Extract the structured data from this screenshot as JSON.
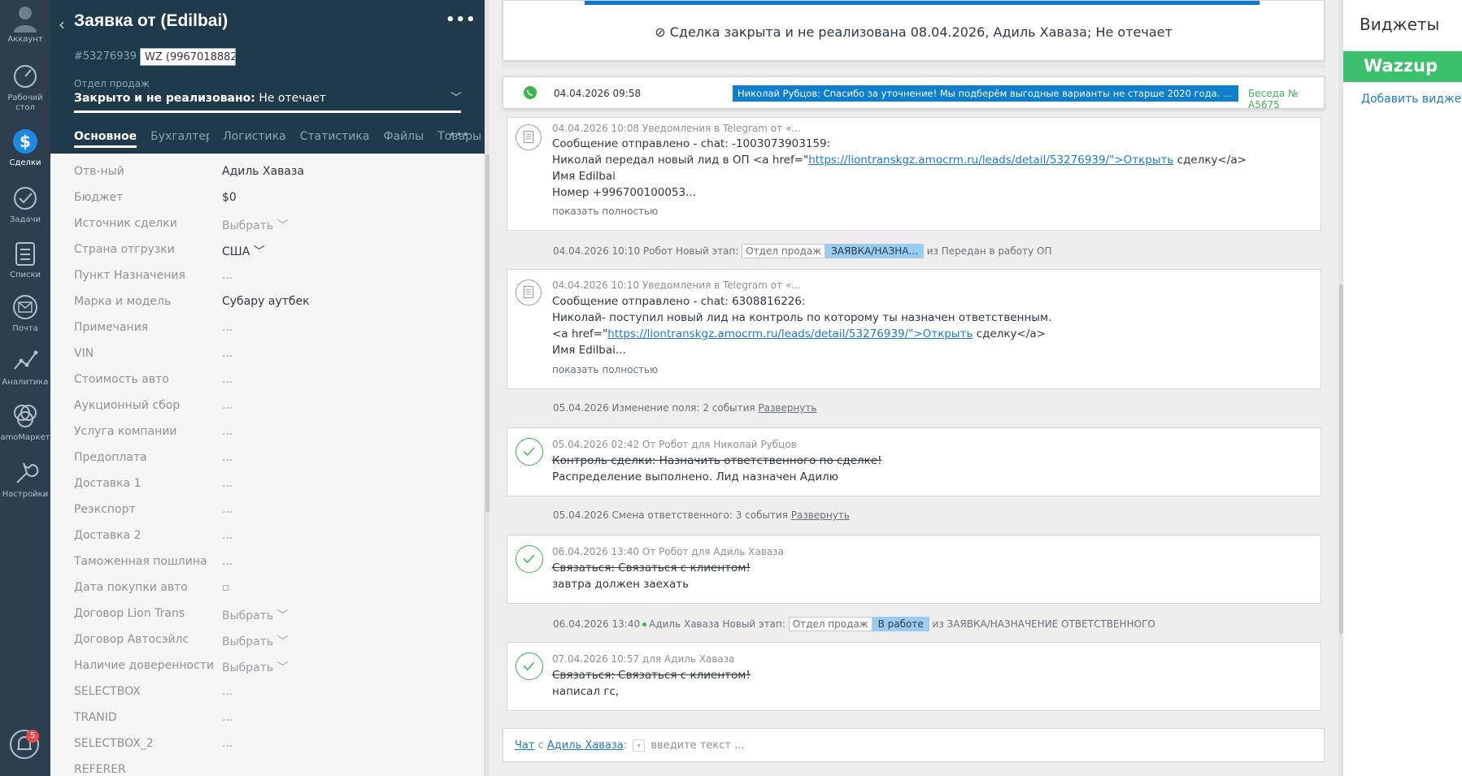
{
  "nav": {
    "account": "Аккаунт",
    "dashboard": "Рабочий стол",
    "leads": "Сделки",
    "tasks": "Задачи",
    "lists": "Списки",
    "mail": "Почта",
    "analytics": "Аналитика",
    "market": "amoМаркет",
    "settings": "Настройки",
    "notifications_count": "5"
  },
  "card": {
    "title": "Заявка от (Edilbai)",
    "more": "•••",
    "deal_id": "#53276939",
    "tag": "WZ (9967018882",
    "pipeline_label": "Отдел продаж",
    "pipeline_stage": "Закрыто и не реализовано:",
    "pipeline_reason": "Не отечает",
    "tabs": [
      "Основное",
      "Бухгалтер",
      "Логистика",
      "Статистика",
      "Файлы",
      "Товары"
    ],
    "tabs_more": "•••",
    "fields": [
      {
        "label": "Отв-ный",
        "value": "Адиль Хаваза",
        "dim": false
      },
      {
        "label": "Бюджет",
        "value": "$0",
        "dim": false
      },
      {
        "label": "Источник сделки",
        "value": "Выбрать ﹀",
        "dim": true
      },
      {
        "label": "Страна отгрузки",
        "value": "США ﹀",
        "dim": false
      },
      {
        "label": "Пункт Назначения",
        "value": "...",
        "dim": true
      },
      {
        "label": "Марка и модель",
        "value": "Субару аутбек",
        "dim": false
      },
      {
        "label": "Примечания",
        "value": "...",
        "dim": true
      },
      {
        "label": "VIN",
        "value": "...",
        "dim": true
      },
      {
        "label": "Стоимость авто",
        "value": "...",
        "dim": true
      },
      {
        "label": "Аукционный сбор",
        "value": "...",
        "dim": true
      },
      {
        "label": "Услуга компании",
        "value": "...",
        "dim": true
      },
      {
        "label": "Предоплата",
        "value": "...",
        "dim": true
      },
      {
        "label": "Доставка 1",
        "value": "...",
        "dim": true
      },
      {
        "label": "Реэкспорт",
        "value": "...",
        "dim": true
      },
      {
        "label": "Доставка 2",
        "value": "...",
        "dim": true
      },
      {
        "label": "Таможенная пошлина",
        "value": "...",
        "dim": true
      },
      {
        "label": "Дата покупки авто",
        "value": "▫",
        "dim": true
      },
      {
        "label": "Договор Lion Trans",
        "value": "Выбрать ﹀",
        "dim": true
      },
      {
        "label": "Договор Автосэйлс",
        "value": "Выбрать ﹀",
        "dim": true
      },
      {
        "label": "Наличие доверенности",
        "value": "Выбрать ﹀",
        "dim": true
      },
      {
        "label": "SELECTBOX",
        "value": "...",
        "dim": true
      },
      {
        "label": "TRANID",
        "value": "...",
        "dim": true
      },
      {
        "label": "SELECTBOX_2",
        "value": "...",
        "dim": true
      },
      {
        "label": "REFERER",
        "value": "",
        "dim": true
      }
    ]
  },
  "feed": {
    "closed_banner": "Сделка закрыта и не реализована 08.04.2026, Адиль Хаваза; Не отечает",
    "wa": {
      "date": "04.04.2026 09:58",
      "message": "Николай Рубцов: Спасибо за уточнение! Мы подберём выгодные варианты не старше 2020 года. Для пер...",
      "conversation": "Беседа № А5675"
    },
    "note1": {
      "meta": "04.04.2026 10:08 Уведомления в Telegram от «...",
      "line1": "Сообщение отправлено - chat: -1003073903159:",
      "line2_pre": "Николай передал новый лид в ОП <a href=\"",
      "line2_link": "https://liontranskgz.amocrm.ru/leads/detail/53276939/\">Открыть",
      "line2_post": " сделку</a>",
      "line3": "Имя Edilbai",
      "line4": "Номер +996700100053...",
      "show": "показать полностью"
    },
    "event1": {
      "text": "04.04.2026 10:10 Робот Новый этап:",
      "chip1": "Отдел продаж",
      "chip2": "ЗАЯВКА/НАЗНА...",
      "after": "из Передан в работу ОП"
    },
    "note2": {
      "meta": "04.04.2026 10:10 Уведомления в Telegram от «...",
      "line1": "Сообщение отправлено - chat: 6308816226:",
      "line2": "Николай- поступил новый лид на контроль по которому ты назначен ответственным.",
      "line3_pre": "<a href=\"",
      "line3_link": "https://liontranskgz.amocrm.ru/leads/detail/53276939/\">Открыть",
      "line3_post": " сделку</a>",
      "line4": "Имя Edilbai...",
      "show": "показать полностью"
    },
    "event2": {
      "text": "05.04.2026 Изменение поля: 2 события",
      "link": "Развернуть"
    },
    "task1": {
      "meta": "05.04.2026 02:42  От Робот для Николай Рубцов",
      "struck": "Контроль сделки: Назначить ответственного по сделке!",
      "result": "Распределение выполнено. Лид назначен Адилю"
    },
    "event3": {
      "text": "05.04.2026 Смена ответственного: 3 события",
      "link": "Развернуть"
    },
    "task2": {
      "meta": "06.04.2026 13:40  От Робот для Адиль Хаваза",
      "struck": "Связаться: Связаться с клиентом!",
      "result": "завтра должен заехать"
    },
    "event4": {
      "text_date": "06.04.2026 13:40",
      "text": "Адиль Хаваза Новый этап:",
      "chip1": "Отдел продаж",
      "chip2": "В работе",
      "after": "из ЗАЯВКА/НАЗНАЧЕНИЕ ОТВЕТСТВЕННОГО"
    },
    "task3": {
      "meta": "07.04.2026 10:57  для Адиль Хаваза",
      "struck": "Связаться: Связаться с клиентом!",
      "result": "написал гс,"
    },
    "chat": {
      "chat_link": "Чат",
      "with": "с",
      "user_link": "Адиль Хаваза",
      "colon": ":",
      "placeholder": "введите текст ..."
    }
  },
  "widgets": {
    "title": "Виджеты",
    "wazzup": "Wazzup",
    "add": "Добавить виджеты"
  }
}
